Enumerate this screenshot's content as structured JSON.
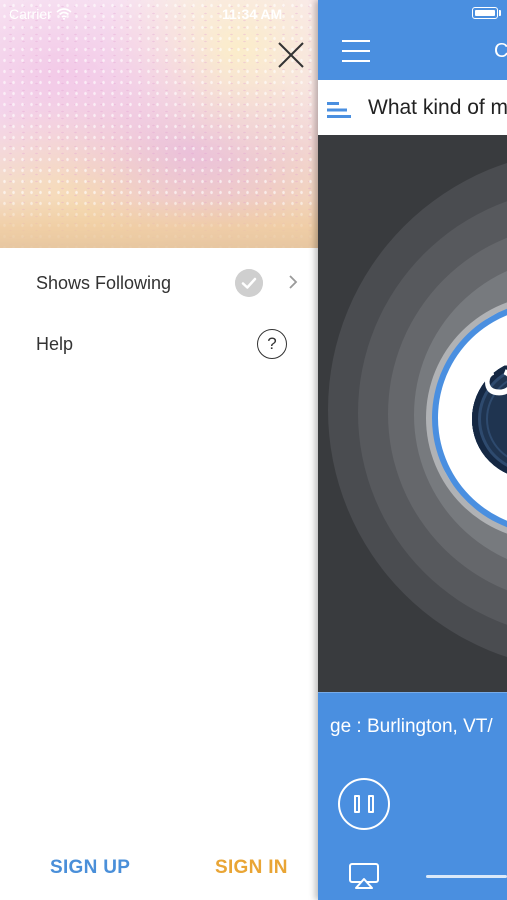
{
  "status_bar": {
    "carrier": "Carrier",
    "time": "11:34 AM"
  },
  "drawer": {
    "menu": {
      "shows_following": "Shows Following",
      "help": "Help"
    },
    "help_glyph": "?",
    "auth": {
      "sign_up": "SIGN UP",
      "sign_in": "SIGN IN"
    }
  },
  "main": {
    "title_partial": "C",
    "search_text": "What kind of m",
    "logo_text": "CH",
    "now_playing": "ge : Burlington, VT/",
    "colors": {
      "accent": "#4a8fe0",
      "sign_up": "#4a8fd9",
      "sign_in": "#e9a535"
    }
  },
  "icons": [
    "wifi-icon",
    "close-icon",
    "check-icon",
    "chevron-right-icon",
    "help-icon",
    "battery-icon",
    "hamburger-icon",
    "bars-icon",
    "pause-icon",
    "airplay-icon"
  ]
}
